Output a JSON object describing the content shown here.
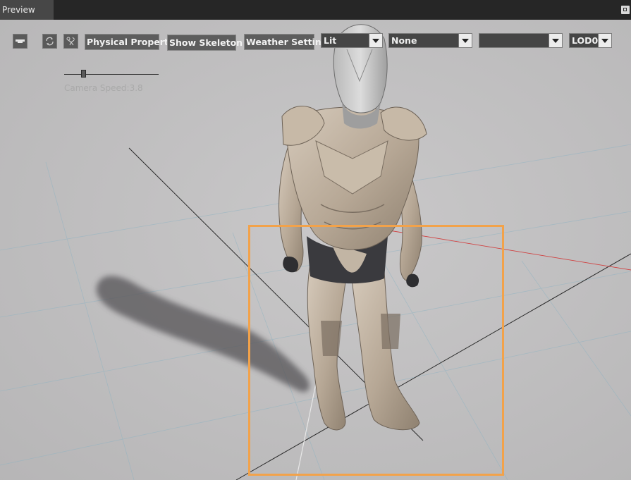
{
  "panel": {
    "tab_label": "Preview",
    "pin_icon": "pin-icon"
  },
  "toolbar": {
    "icons": [
      "view-mode-icon",
      "refresh-icon",
      "animation-icon"
    ],
    "physical_property_label": "Physical Property",
    "show_skeleton_label": "Show Skeleton",
    "weather_settings_label": "Weather Settings",
    "lighting_mode": "Lit",
    "animation_select": "None",
    "empty_select": "",
    "lod_select": "LOD0"
  },
  "camera": {
    "speed_label": "Camera Speed:3.8",
    "speed_value": 3.8
  },
  "colors": {
    "viewport_bg": "#c3c2c3",
    "selection_outline": "#f2a24a",
    "x_axis": "#d04040",
    "grid_line": "#8fb3c2"
  }
}
